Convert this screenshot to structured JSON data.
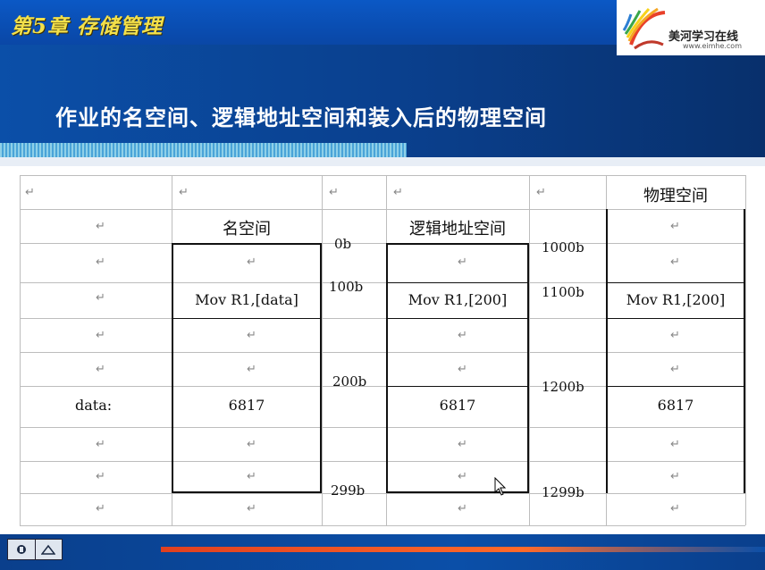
{
  "header": {
    "chapter": "第5章 存储管理",
    "logo_text": "美河学习在线",
    "logo_url": "www.eimhe.com",
    "title": "作业的名空间、逻辑地址空间和装入后的物理空间"
  },
  "table": {
    "paragraph_mark": "↵",
    "headers": {
      "name_space": "名空间",
      "logical_space": "逻辑地址空间",
      "physical_space": "物理空间"
    },
    "label_data": "data:",
    "name_instr": "Mov R1,[data]",
    "logical_instr": "Mov R1,[200]",
    "physical_instr": "Mov R1,[200]",
    "value_name": "6817",
    "value_logical": "6817",
    "value_physical": "6817",
    "logical_addrs": [
      "0b",
      "100b",
      "200b",
      "299b"
    ],
    "physical_addrs": [
      "1000b",
      "1100b",
      "1200b",
      "1299b"
    ]
  },
  "colors": {
    "header_blue": "#0b4fa8",
    "chapter_yellow": "#f3e04a"
  }
}
